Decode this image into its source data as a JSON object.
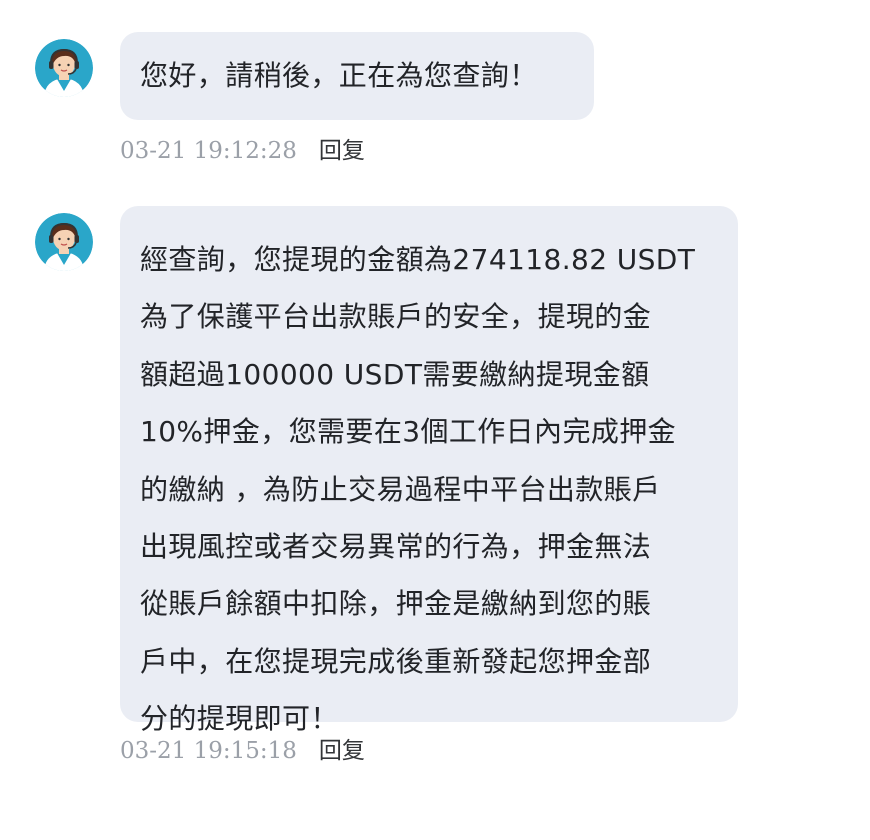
{
  "messages": [
    {
      "avatar_icon": "customer-service-agent-icon",
      "text": "您好，請稍後，正在為您查詢！",
      "time": "03-21 19:12:28",
      "reply_label": "回复"
    },
    {
      "avatar_icon": "customer-service-agent-icon",
      "text": "經查詢，您提現的金額為274118.82 USDT\n為了保護平台出款賬戶的安全，提現的金\n額超過100000 USDT需要繳納提現金額\n10%押金，您需要在3個工作日內完成押金\n的繳納 ，為防止交易過程中平台出款賬戶\n出現風控或者交易異常的行為，押金無法\n從賬戶餘額中扣除，押金是繳納到您的賬\n戶中，在您提現完成後重新發起您押金部\n分的提現即可！",
      "time": "03-21 19:15:18",
      "reply_label": "回复"
    }
  ],
  "colors": {
    "bubble_bg": "#eaedf4",
    "avatar_bg": "#2aa6c9",
    "timestamp": "#9ba0a8",
    "text": "#222428"
  }
}
